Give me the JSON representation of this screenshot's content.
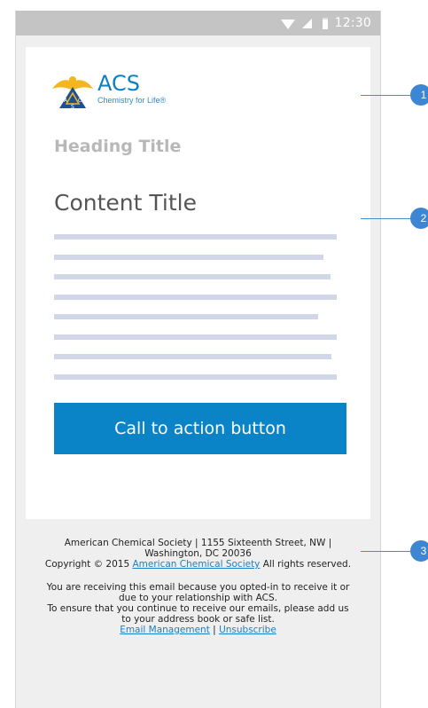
{
  "status": {
    "time": "12:30"
  },
  "logo": {
    "name": "ACS",
    "tagline": "Chemistry for Life®",
    "badge_letters": [
      "A",
      "C",
      "S"
    ]
  },
  "card": {
    "heading_title": "Heading Title",
    "content_title": "Content Title",
    "cta_label": "Call to action button"
  },
  "footer": {
    "address_line1": "American Chemical Society | 1155 Sixteenth Street, NW |",
    "address_line2": "Washington, DC 20036",
    "copyright_prefix": "Copyright © 2015",
    "copyright_link": "American Chemical Society",
    "copyright_suffix": "All rights reserved.",
    "notice_line1": "You are receiving this email because you opted-in to receive it or",
    "notice_line2": "due to your relationship with ACS.",
    "notice_line3": "To ensure that you continue to receive our emails, please add us",
    "notice_line4": "to your address book or safe list.",
    "email_management": "Email Management",
    "separator": "|",
    "unsubscribe": "Unsubscribe"
  },
  "callouts": [
    "1",
    "2",
    "3"
  ],
  "colors": {
    "accent": "#0a84c6",
    "placeholder": "#d1d6e8",
    "callout": "#3d86d4"
  }
}
